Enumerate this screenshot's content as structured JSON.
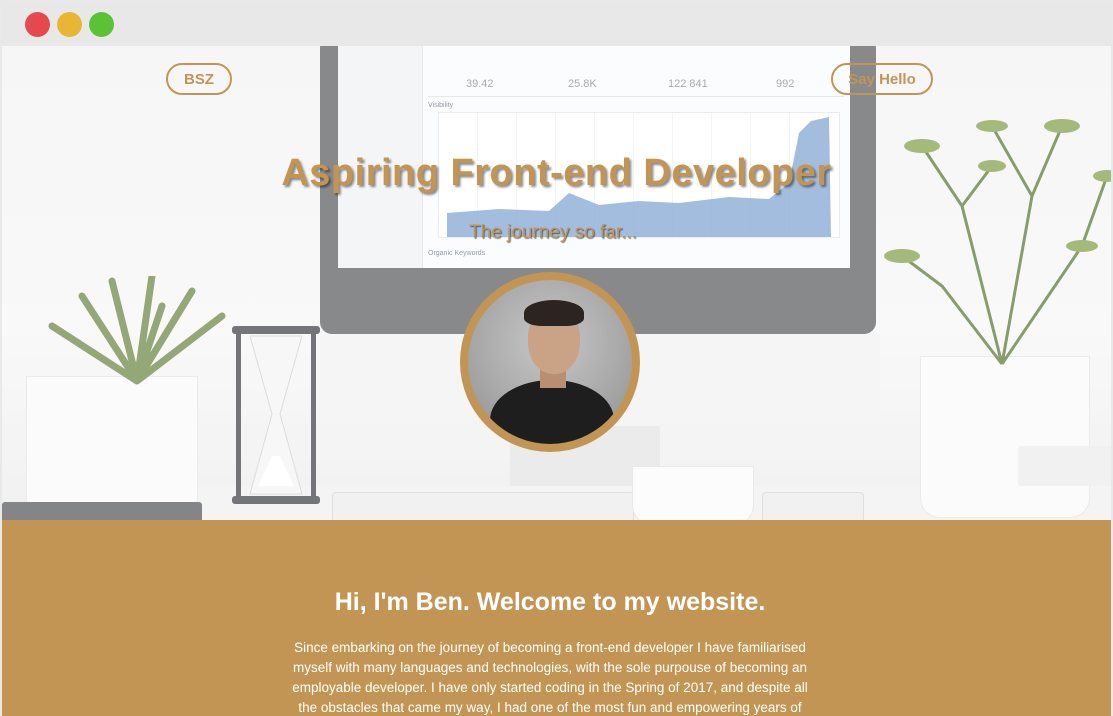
{
  "window": {
    "controls": [
      "close",
      "minimize",
      "maximize"
    ],
    "colors": {
      "close": "#e5484d",
      "minimize": "#e8b634",
      "maximize": "#5bc236"
    }
  },
  "nav": {
    "logo": "BSZ",
    "cta": "Say Hello"
  },
  "hero": {
    "title": "Aspiring Front-end Developer",
    "subtitle": "The journey so far...",
    "screen": {
      "visibility_label": "Visibility",
      "stats": [
        "39.42",
        "25.8K",
        "122 841",
        "992"
      ],
      "organic_label": "Organic Keywords"
    }
  },
  "about": {
    "heading": "Hi, I'm Ben. Welcome to my website.",
    "body": "Since embarking on the journey of becoming a front-end developer I have familiarised myself with many languages and technologies, with the sole purpouse of becoming an employable developer. I have only started coding in the Spring of 2017, and despite all the obstacles that came my way, I had one of the most fun and empowering years of my"
  },
  "colors": {
    "accent": "#c29554",
    "text_on_accent": "#ffffff"
  }
}
